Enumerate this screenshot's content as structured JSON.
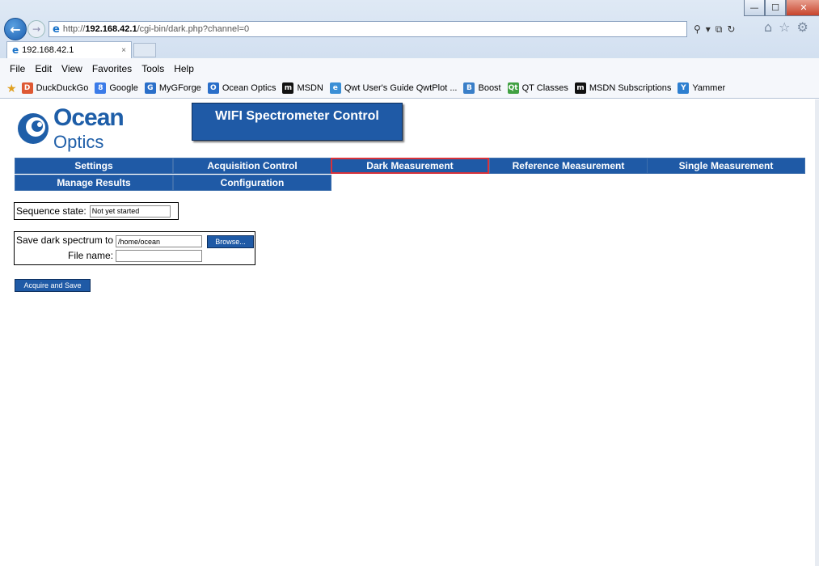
{
  "browser": {
    "url_prefix": "http://",
    "url_host": "192.168.42.1",
    "url_path": "/cgi-bin/dark.php?channel=0",
    "tab_title": "192.168.42.1",
    "tab_close": "×",
    "menu": [
      "File",
      "Edit",
      "View",
      "Favorites",
      "Tools",
      "Help"
    ],
    "favorites": [
      {
        "label": "DuckDuckGo",
        "icon": "duckduckgo-icon",
        "color": "#de5833",
        "glyph": "D"
      },
      {
        "label": "Google",
        "icon": "google-icon",
        "color": "#3b7be8",
        "glyph": "8"
      },
      {
        "label": "MyGForge",
        "icon": "myg-forge-icon",
        "color": "#2a6fc9",
        "glyph": "G"
      },
      {
        "label": "Ocean Optics",
        "icon": "ocean-optics-icon",
        "color": "#2a6fc9",
        "glyph": "O"
      },
      {
        "label": "MSDN",
        "icon": "msdn-icon",
        "color": "#111111",
        "glyph": "m"
      },
      {
        "label": "Qwt User's Guide QwtPlot ...",
        "icon": "ie-page-icon",
        "color": "#3a8fd6",
        "glyph": "e"
      },
      {
        "label": "Boost",
        "icon": "boost-icon",
        "color": "#3a7fc8",
        "glyph": "B"
      },
      {
        "label": "QT Classes",
        "icon": "qt-icon",
        "color": "#41a142",
        "glyph": "Qt"
      },
      {
        "label": "MSDN Subscriptions",
        "icon": "msdn-icon",
        "color": "#111111",
        "glyph": "m"
      },
      {
        "label": "Yammer",
        "icon": "yammer-icon",
        "color": "#2d7fd0",
        "glyph": "Y"
      }
    ]
  },
  "page": {
    "logo_line1": "Ocean",
    "logo_line2": "Optics",
    "title": "WIFI Spectrometer Control",
    "nav": [
      "Settings",
      "Acquisition Control",
      "Dark Measurement",
      "Reference Measurement",
      "Single Measurement",
      "Manage Results",
      "Configuration"
    ],
    "active_nav": "Dark Measurement",
    "sequence_label": "Sequence state:",
    "sequence_value": "Not yet started",
    "save_label": "Save dark spectrum to",
    "save_path": "/home/ocean",
    "browse_label": "Browse...",
    "file_name_label": "File name:",
    "file_name_value": "",
    "acquire_label": "Acquire and Save"
  },
  "colors": {
    "nav_bg": "#1f5aa6",
    "active_border": "#d8323a",
    "logo_blue": "#1e5ea8"
  }
}
